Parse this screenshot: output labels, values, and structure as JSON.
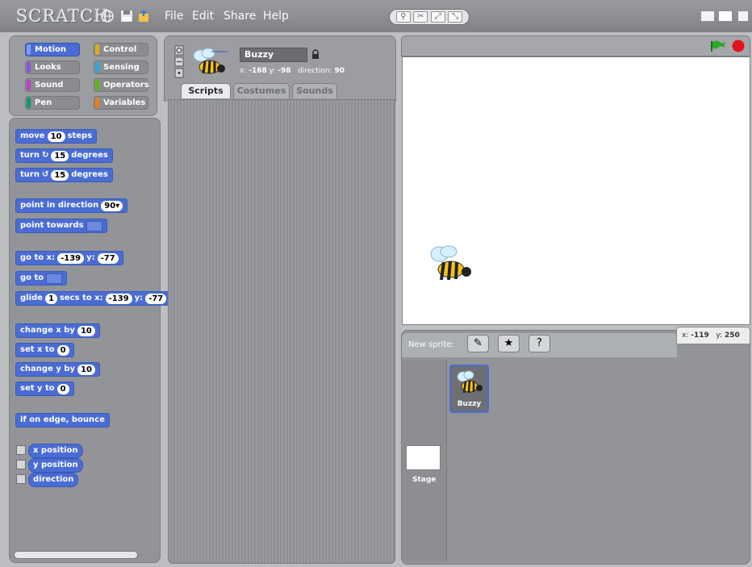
{
  "app": {
    "logo": "SCRATCH"
  },
  "menu": [
    "File",
    "Edit",
    "Share",
    "Help"
  ],
  "toolbar": {
    "icons": [
      "globe-icon",
      "save-icon",
      "share-icon"
    ]
  },
  "categories": [
    {
      "label": "Motion",
      "color": "#4a6cd4",
      "active": true
    },
    {
      "label": "Control",
      "color": "#e1a91a"
    },
    {
      "label": "Looks",
      "color": "#8a55d7"
    },
    {
      "label": "Sensing",
      "color": "#2ca5e2"
    },
    {
      "label": "Sound",
      "color": "#bb42c3"
    },
    {
      "label": "Operators",
      "color": "#5cb712"
    },
    {
      "label": "Pen",
      "color": "#0e9a6c"
    },
    {
      "label": "Variables",
      "color": "#ee7d16"
    }
  ],
  "blocks": {
    "move": {
      "pre": "move",
      "n": "10",
      "post": "steps"
    },
    "turn_cw": {
      "pre": "turn",
      "n": "15",
      "post": "degrees"
    },
    "turn_ccw": {
      "pre": "turn",
      "n": "15",
      "post": "degrees"
    },
    "point_dir": {
      "pre": "point in direction",
      "n": "90"
    },
    "point_towards": {
      "pre": "point towards"
    },
    "goto_xy": {
      "pre": "go to x:",
      "x": "-139",
      "mid": "y:",
      "y": "-77"
    },
    "goto": {
      "pre": "go to"
    },
    "glide": {
      "pre": "glide",
      "n": "1",
      "mid": "secs to x:",
      "x": "-139",
      "mid2": "y:",
      "y": "-77"
    },
    "change_x": {
      "pre": "change x by",
      "n": "10"
    },
    "set_x": {
      "pre": "set x to",
      "n": "0"
    },
    "change_y": {
      "pre": "change y by",
      "n": "10"
    },
    "set_y": {
      "pre": "set y to",
      "n": "0"
    },
    "bounce": {
      "pre": "if on edge, bounce"
    },
    "x_position": "x position",
    "y_position": "y position",
    "direction": "direction"
  },
  "sprite": {
    "name": "Buzzy",
    "x_label": "x:",
    "x": "-168",
    "y_label": "y:",
    "y": "-98",
    "dir_label": "direction:",
    "dir": "90"
  },
  "tabs": [
    "Scripts",
    "Costumes",
    "Sounds"
  ],
  "corral": {
    "new_sprite_label": "New sprite:",
    "mouse_x_label": "x:",
    "mouse_x": "-119",
    "mouse_y_label": "y:",
    "mouse_y": "250",
    "stage_label": "Stage",
    "sprite_label": "Buzzy"
  },
  "colors": {
    "motion": "#4a6cd4",
    "green_flag": "#2fa82f",
    "stop": "#e0141a"
  }
}
